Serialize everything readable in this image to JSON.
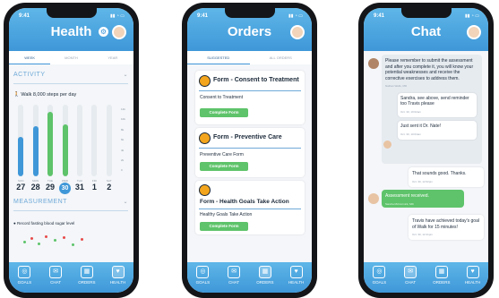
{
  "nav": {
    "goals": "GOALS",
    "chat": "CHAT",
    "orders": "ORDERS",
    "health": "HEALTH"
  },
  "time": "9:41",
  "screen1": {
    "title": "Health",
    "tabs": [
      "WEEK",
      "MONTH",
      "YEAR"
    ],
    "activity_label": "ACTIVITY",
    "walk_goal": "Walk 8,000 steps per day",
    "y_labels": [
      "12k",
      "10k",
      "8k",
      "6k",
      "4k",
      "2k",
      "0"
    ],
    "days": [
      {
        "name": "SUN",
        "num": "27",
        "level": 0.55,
        "color": "#3f97d8"
      },
      {
        "name": "MON",
        "num": "28",
        "level": 0.7,
        "color": "#3f97d8"
      },
      {
        "name": "TUE",
        "num": "29",
        "level": 0.9,
        "color": "#5ec36a"
      },
      {
        "name": "WED",
        "num": "30",
        "level": 0.72,
        "color": "#5ec36a"
      },
      {
        "name": "THU",
        "num": "31",
        "level": 0,
        "color": "#3f97d8"
      },
      {
        "name": "FRI",
        "num": "1",
        "level": 0,
        "color": "#3f97d8"
      },
      {
        "name": "SAT",
        "num": "2",
        "level": 0,
        "color": "#3f97d8"
      }
    ],
    "selected_day": "30",
    "measurement_label": "MEASUREMENT",
    "measurement_item": "Record fasting blood sugar level"
  },
  "screen2": {
    "title": "Orders",
    "tabs": [
      "SUGGESTED",
      "ALL ORDERS"
    ],
    "cards": [
      {
        "title": "Form - Consent to Treatment",
        "subtitle": "Consent to Treatment",
        "button": "Complete Form"
      },
      {
        "title": "Form - Preventive Care",
        "subtitle": "Preventive Care Form",
        "button": "Complete Form"
      },
      {
        "title": "Form - Health Goals Take Action",
        "subtitle": "Healthy Goals Take Action",
        "button": "Complete Form"
      }
    ]
  },
  "screen3": {
    "title": "Chat",
    "messages": [
      {
        "text": "Please remember to submit the assessment and after you complete it, you will know your potential weaknesses and receive the corrective exercises to address them.",
        "meta": "Nathan Wells, MD"
      },
      {
        "text": "Sandra, see above, send reminder too Travis please",
        "meta": "Oct. 30, 10:02am"
      },
      {
        "text": "Just sent it Dr. Nate!",
        "meta": "Oct. 30, 10:04am"
      },
      {
        "text": "That sounds good. Thanks.",
        "meta": "Oct. 30, 12:02pm"
      },
      {
        "text": "Assessment received.",
        "meta": "Sandra McCormick, MD"
      },
      {
        "text": "Travis have achieved today's goal of Walk for 15 minutes!",
        "meta": "Oct. 30, 12:41pm"
      }
    ]
  }
}
